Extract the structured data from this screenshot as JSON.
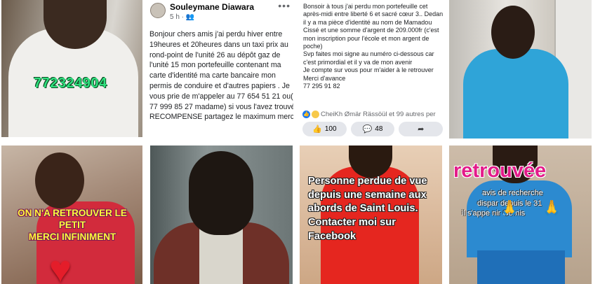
{
  "tiles": {
    "t1": {
      "phone": "772324904"
    },
    "t2": {
      "author": "Souleymane Diawara",
      "meta": "5 h · ",
      "meta_icon": "friends-icon",
      "body": "Bonjour chers amis j'ai perdu hiver entre 19heures et 20heures dans un taxi  prix au rond-point de l'unité 26  au dépôt gaz de l'unité 15  mon portefeuille  contenant ma carte d'identité ma carte bancaire mon permis de conduire et d'autres papiers . Je vous prie de m'appeler au 77 654 51 21 ou(  77 999 85 27  madame)  si vous l'avez trouvé   RECOMPENSE partagez le maximum merci"
    },
    "t3": {
      "body": "Bonsoir à tous j'ai perdu mon portefeuille cet après-midi entre liberté 6 et sacré cœur 3.. Dedans il y a ma pièce d'identité au nom de Mamadou Cissé et une somme d'argent  de 209.000fr (c'est mon inscription pour l'école et mon argent de poche)\nSvp faites moi signe au numéro ci-dessous car c'est primordial et il y va de mon avenir\nJe compte sur vous pour m'aider à le retrouver\nMerci d'avance\n    77 295 91 82",
      "reactions": "CheiKh Ømär Rässöül et 99 autres per",
      "like_count": "100",
      "comment_count": "48"
    },
    "t5": {
      "caption_1": "ON N'A RETROUVER LE",
      "caption_2": "PETIT",
      "caption_3": "MERCI INFINIMENT"
    },
    "t7": {
      "caption": "Personne perdue de vue depuis une semaine aux abords de Saint Louis. Contacter moi sur Facebook"
    },
    "t8": {
      "title": "retrouvée",
      "line_1": "avis de recherche",
      "line_2": "dispar     depuis le 31",
      "line_3": "il s'appe          nir Gomis"
    }
  },
  "colors": {
    "phone_text": "#2fe07e",
    "caption_yellow": "#fffb3b",
    "retrouvee_pink": "#e31b8a",
    "facebook_blue": "#1877f2"
  }
}
